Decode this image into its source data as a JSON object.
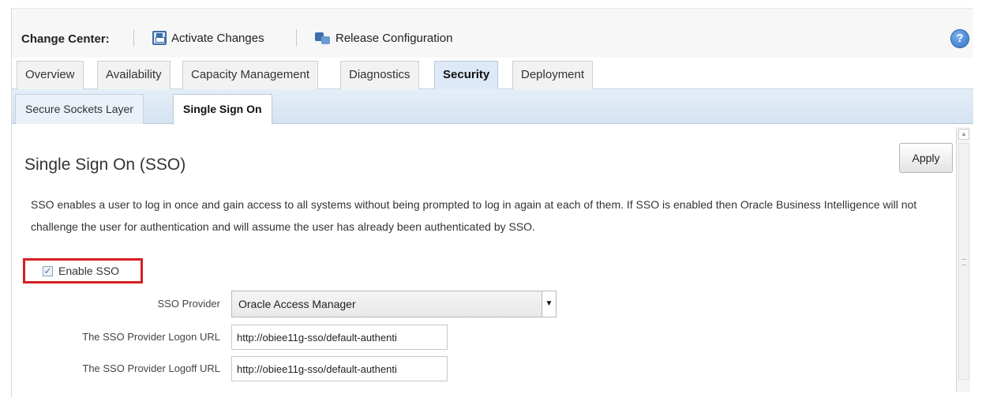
{
  "change_center": {
    "label": "Change Center:",
    "activate_label": "Activate Changes",
    "release_label": "Release Configuration",
    "help": "?"
  },
  "tabs": [
    {
      "label": "Overview"
    },
    {
      "label": "Availability"
    },
    {
      "label": "Capacity Management"
    },
    {
      "label": "Diagnostics"
    },
    {
      "label": "Security",
      "active": true
    },
    {
      "label": "Deployment"
    }
  ],
  "subtabs": [
    {
      "label": "Secure Sockets Layer"
    },
    {
      "label": "Single Sign On",
      "active": true
    }
  ],
  "content": {
    "title": "Single Sign On (SSO)",
    "apply_label": "Apply",
    "description": "SSO enables a user to log in once and gain access to all systems without being prompted to log in again at each of them. If SSO is enabled then Oracle Business Intelligence will not challenge the user for authentication and will assume the user has already been authenticated by SSO.",
    "enable_sso": {
      "label": "Enable SSO",
      "checked": true
    },
    "provider_label": "SSO Provider",
    "provider_value": "Oracle Access Manager",
    "logon_label": "The SSO Provider Logon URL",
    "logon_value": "http://obiee11g-sso/default-authenti",
    "logoff_label": "The SSO Provider Logoff URL",
    "logoff_value": "http://obiee11g-sso/default-authenti"
  },
  "colors": {
    "highlight_border": "#d51e24",
    "active_tab": "#dde9f6",
    "subtab_bar": "#d5e3f1"
  }
}
